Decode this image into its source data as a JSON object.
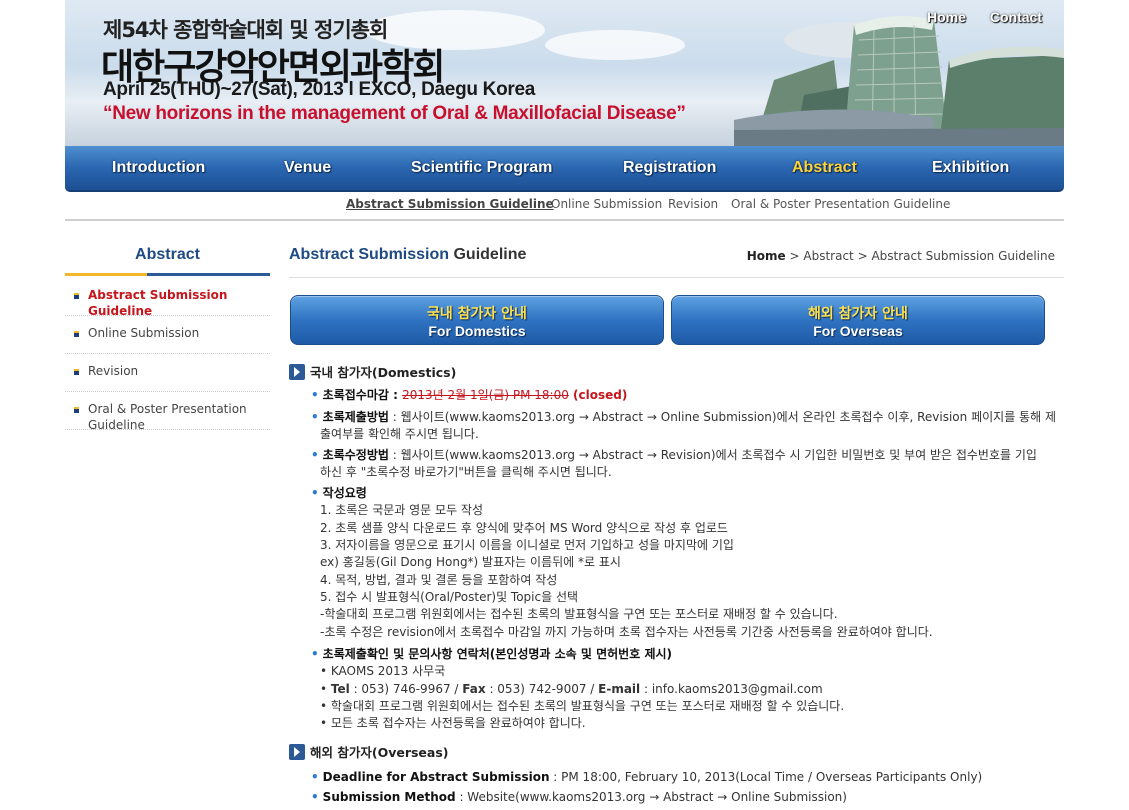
{
  "header": {
    "title_line1": "제54차 종합학술대회 및 정기총회",
    "title_line2": "대한구강악안면외과학회",
    "date_venue": "April 25(THU)~27(Sat), 2013 l EXCO, Daegu Korea",
    "slogan": "“New horizons in the management of Oral & Maxillofacial Disease”",
    "top_links": [
      "Home",
      "Contact"
    ]
  },
  "nav": {
    "items": [
      "Introduction",
      "Venue",
      "Scientific Program",
      "Registration",
      "Abstract",
      "Exhibition"
    ],
    "active": "Abstract"
  },
  "subnav": {
    "items": [
      "Abstract Submission Guideline",
      "Online Submission",
      "Revision",
      "Oral & Poster Presentation Guideline"
    ],
    "active": "Abstract Submission Guideline"
  },
  "sidebar": {
    "title": "Abstract",
    "items": [
      {
        "label_line1": "Abstract Submission",
        "label_line2": "Guideline"
      },
      {
        "label_line1": "Online Submission",
        "label_line2": ""
      },
      {
        "label_line1": "Revision",
        "label_line2": ""
      },
      {
        "label_line1": "Oral & Poster Presentation",
        "label_line2": "Guideline"
      }
    ]
  },
  "content": {
    "title_part1": "Abstract Submission",
    "title_part2": "Guideline",
    "breadcrumb": {
      "home": "Home",
      "rest": " > Abstract > Abstract Submission Guideline"
    },
    "buttons": [
      {
        "kr": "국내 참가자 안내",
        "en": "For Domestics"
      },
      {
        "kr": "해외 참가자 안내",
        "en": "For Overseas"
      }
    ],
    "domestic": {
      "heading": "국내 참가자(Domestics)",
      "deadline_label": "초록접수마감 : ",
      "deadline_strike": "2013년 2월 1일(금) PM 18:00",
      "deadline_status": " (closed)",
      "method_label": "초록제출방법",
      "method_line1": " : 웹사이트(www.kaoms2013.org → Abstract → Online Submission)에서 온라인 초록접수 이후, Revision 페이지를 통해 제",
      "method_line2": "출여부를 확인해 주시면 됩니다.",
      "revise_label": "초록수정방법",
      "revise_line1": " : 웹사이트(www.kaoms2013.org → Abstract → Revision)에서 초록접수 시 기입한 비밀번호 및 부여 받은 접수번호를 기입",
      "revise_line2": "하신 후 \"초록수정 바로가기\"버튼을 클릭해 주시면 됩니다.",
      "guide_label": "작성요령",
      "guide_lines": [
        "1. 초록은 국문과 영문 모두 작성",
        "2. 초록 샘플 양식 다운로드 후 양식에 맞추어 MS Word 양식으로 작성 후 업로드",
        "3. 저자이름을 영문으로 표기시 이름을 이니셜로 먼저 기입하고 성을 마지막에 기입",
        "ex) 홍길동(Gil Dong Hong*) 발표자는 이름뒤에 *로 표시",
        "4. 목적, 방법, 결과 및 결론 등을 포함하여 작성",
        "5. 접수 시 발표형식(Oral/Poster)및 Topic을 선택",
        "-학술대회 프로그램 위원회에서는 접수된 초록의 발표형식을 구연 또는 포스터로 재배정 할 수 있습니다.",
        "-초록 수정은 revision에서 초록접수 마감일 까지 가능하며 초록 접수자는 사전등록 기간중 사전등록을 완료하여야 합니다."
      ],
      "contact_label": "초록제출확인 및 문의사항 연락처(본인성명과 소속 및 면허번호 제시)",
      "contact_org": "• KAOMS 2013 사무국",
      "tel_label": "Tel",
      "tel_value": " : 053) 746-9967 / ",
      "fax_label": "Fax",
      "fax_value": " : 053) 742-9007 / ",
      "email_label": "E-mail",
      "email_value": " : info.kaoms2013@gmail.com",
      "note1": "• 학술대회 프로그램 위원회에서는 접수된 초록의 발표형식을 구연 또는 포스터로 재배정 할 수 있습니다.",
      "note2": "• 모든 초록 접수자는 사전등록을 완료하여야 합니다."
    },
    "overseas": {
      "heading": "해외 참가자(Overseas)",
      "deadline_label": "Deadline for Abstract Submission",
      "deadline_value": " : PM 18:00, February 10, 2013(Local Time / Overseas Participants Only)",
      "method_label": "Submission Method",
      "method_value": " : Website(www.kaoms2013.org → Abstract → Online Submission)"
    }
  }
}
